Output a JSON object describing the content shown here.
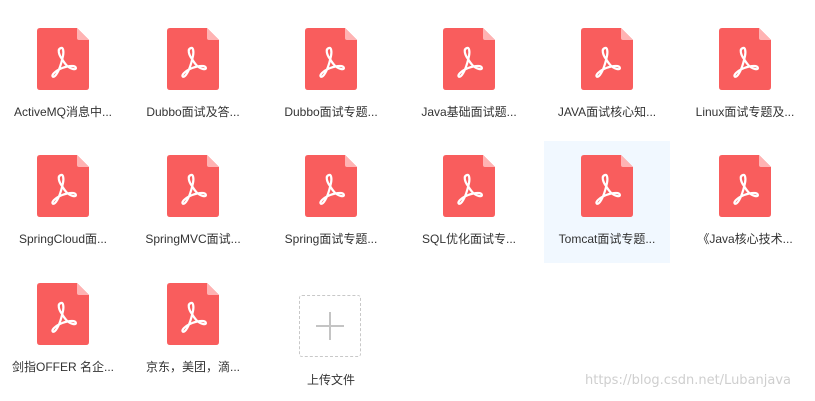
{
  "files": [
    {
      "name": "ActiveMQ消息中...",
      "icon": "pdf-icon"
    },
    {
      "name": "Dubbo面试及答...",
      "icon": "pdf-icon"
    },
    {
      "name": "Dubbo面试专题...",
      "icon": "pdf-icon"
    },
    {
      "name": "Java基础面试题...",
      "icon": "pdf-icon"
    },
    {
      "name": "JAVA面试核心知...",
      "icon": "pdf-icon"
    },
    {
      "name": "Linux面试专题及...",
      "icon": "pdf-icon"
    },
    {
      "name": "SpringCloud面...",
      "icon": "pdf-icon"
    },
    {
      "name": "SpringMVC面试...",
      "icon": "pdf-icon"
    },
    {
      "name": "Spring面试专题...",
      "icon": "pdf-icon"
    },
    {
      "name": "SQL优化面试专...",
      "icon": "pdf-icon"
    },
    {
      "name": "Tomcat面试专题...",
      "icon": "pdf-icon",
      "selected": true
    },
    {
      "name": "《Java核心技术...",
      "icon": "pdf-icon"
    },
    {
      "name": "剑指OFFER  名企...",
      "icon": "pdf-icon"
    },
    {
      "name": "京东，美团，滴...",
      "icon": "pdf-icon"
    }
  ],
  "upload": {
    "label": "上传文件",
    "icon": "plus-icon"
  },
  "watermark": "https://blog.csdn.net/Lubanjava",
  "colors": {
    "pdf_red": "#f95d5d",
    "pdf_fold": "#ffb3b3",
    "selected_bg": "#f1f8ff",
    "text": "#333333"
  }
}
